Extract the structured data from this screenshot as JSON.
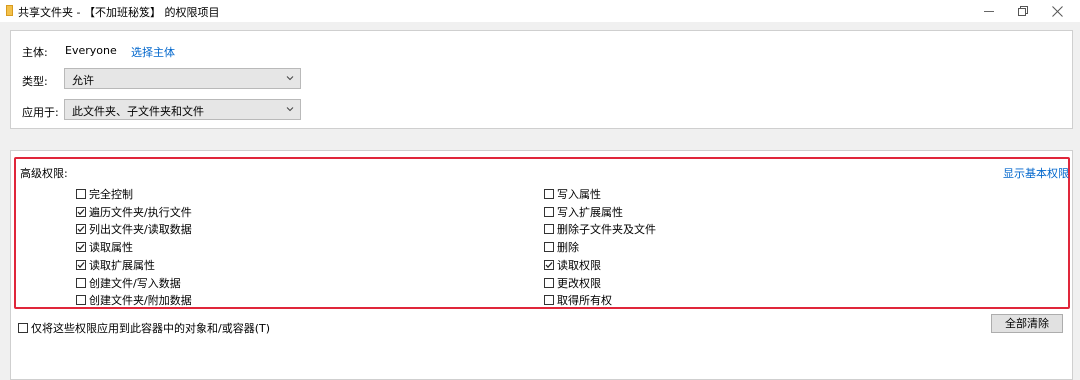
{
  "window": {
    "title": "共享文件夹 - 【不加班秘笈】 的权限项目"
  },
  "principal": {
    "label": "主体:",
    "value": "Everyone",
    "select_link": "选择主体"
  },
  "type": {
    "label": "类型:",
    "selected": "允许"
  },
  "applies_to": {
    "label": "应用于:",
    "selected": "此文件夹、子文件夹和文件"
  },
  "advanced": {
    "heading": "高级权限:",
    "show_basic_link": "显示基本权限",
    "left_permissions": [
      {
        "label": "完全控制",
        "checked": false
      },
      {
        "label": "遍历文件夹/执行文件",
        "checked": true
      },
      {
        "label": "列出文件夹/读取数据",
        "checked": true
      },
      {
        "label": "读取属性",
        "checked": true
      },
      {
        "label": "读取扩展属性",
        "checked": true
      },
      {
        "label": "创建文件/写入数据",
        "checked": false
      },
      {
        "label": "创建文件夹/附加数据",
        "checked": false
      }
    ],
    "right_permissions": [
      {
        "label": "写入属性",
        "checked": false
      },
      {
        "label": "写入扩展属性",
        "checked": false
      },
      {
        "label": "删除子文件夹及文件",
        "checked": false
      },
      {
        "label": "删除",
        "checked": false
      },
      {
        "label": "读取权限",
        "checked": true
      },
      {
        "label": "更改权限",
        "checked": false
      },
      {
        "label": "取得所有权",
        "checked": false
      }
    ]
  },
  "apply_only": {
    "label": "仅将这些权限应用到此容器中的对象和/或容器(T)",
    "checked": false
  },
  "clear_all_button": "全部清除",
  "colors": {
    "accent_link": "#0066cc",
    "highlight_border": "#e0263a"
  }
}
